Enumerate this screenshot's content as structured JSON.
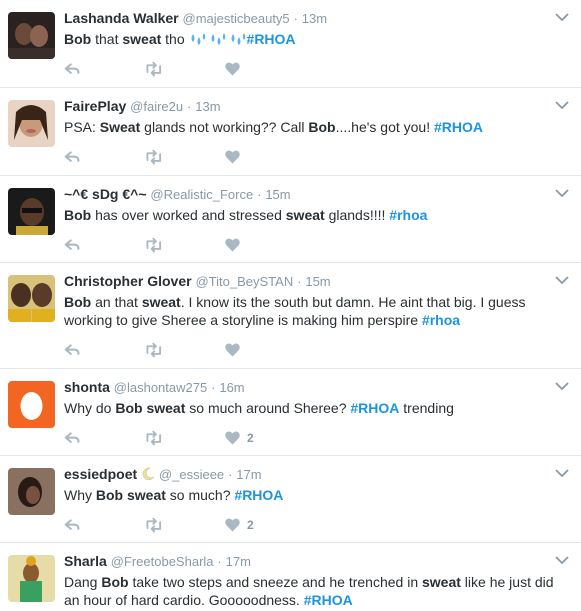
{
  "colors": {
    "accent": "#1b95e0",
    "muted": "#8899a6",
    "text": "#292f33"
  },
  "tweets": [
    {
      "name": "Lashanda Walker",
      "handle": "@majesticbeauty5",
      "sep": "·",
      "time": "13m",
      "parts": [
        {
          "t": "Bob",
          "s": "b"
        },
        {
          "t": " that "
        },
        {
          "t": "sweat",
          "s": "b"
        },
        {
          "t": " tho "
        },
        {
          "t": "💦💦💦",
          "s": "emoji"
        },
        {
          "t": "#RHOA",
          "s": "tag"
        }
      ],
      "likes": ""
    },
    {
      "name": "FairePlay",
      "handle": "@faire2u",
      "sep": "·",
      "time": "13m",
      "parts": [
        {
          "t": "PSA: "
        },
        {
          "t": "Sweat",
          "s": "b"
        },
        {
          "t": " glands not working??  Call "
        },
        {
          "t": "Bob",
          "s": "b"
        },
        {
          "t": "....he's got you! "
        },
        {
          "t": "#RHOA",
          "s": "tag"
        }
      ],
      "likes": ""
    },
    {
      "name": "~^€ sDg €^~",
      "handle": "@Realistic_Force",
      "sep": "·",
      "time": "15m",
      "parts": [
        {
          "t": "Bob",
          "s": "b"
        },
        {
          "t": " has over worked and stressed "
        },
        {
          "t": "sweat",
          "s": "b"
        },
        {
          "t": " glands!!!! "
        },
        {
          "t": "#rhoa",
          "s": "tag"
        }
      ],
      "likes": ""
    },
    {
      "name": "Christopher Glover",
      "handle": "@Tito_BeySTAN",
      "sep": "·",
      "time": "15m",
      "parts": [
        {
          "t": "Bob",
          "s": "b"
        },
        {
          "t": " an that "
        },
        {
          "t": "sweat",
          "s": "b"
        },
        {
          "t": ". I know its the south but damn. He aint that big. I guess working to give Sheree a storyline is making him perspire "
        },
        {
          "t": "#rhoa",
          "s": "tag"
        }
      ],
      "likes": ""
    },
    {
      "name": "shonta",
      "handle": "@lashontaw275",
      "sep": "·",
      "time": "16m",
      "parts": [
        {
          "t": "Why do "
        },
        {
          "t": "Bob",
          "s": "b"
        },
        {
          "t": " "
        },
        {
          "t": "sweat",
          "s": "b"
        },
        {
          "t": " so much around Sheree?  "
        },
        {
          "t": "#RHOA",
          "s": "tag"
        },
        {
          "t": " trending"
        }
      ],
      "likes": "2"
    },
    {
      "name": "essiedpoet",
      "name_suffix": "moon",
      "handle": "@_essieee",
      "sep": "·",
      "time": "17m",
      "parts": [
        {
          "t": "Why "
        },
        {
          "t": "Bob",
          "s": "b"
        },
        {
          "t": " "
        },
        {
          "t": "sweat",
          "s": "b"
        },
        {
          "t": " so much? "
        },
        {
          "t": "#RHOA",
          "s": "tag"
        }
      ],
      "likes": "2"
    },
    {
      "name": "Sharla",
      "handle": "@FreetobeSharla",
      "sep": "·",
      "time": "17m",
      "parts": [
        {
          "t": "Dang "
        },
        {
          "t": "Bob",
          "s": "b"
        },
        {
          "t": " take two steps and sneeze and he trenched in "
        },
        {
          "t": "sweat",
          "s": "b"
        },
        {
          "t": " like he just did an hour of hard cardio. Gooooodness.  "
        },
        {
          "t": "#RHOA",
          "s": "tag"
        }
      ],
      "likes": ""
    }
  ]
}
